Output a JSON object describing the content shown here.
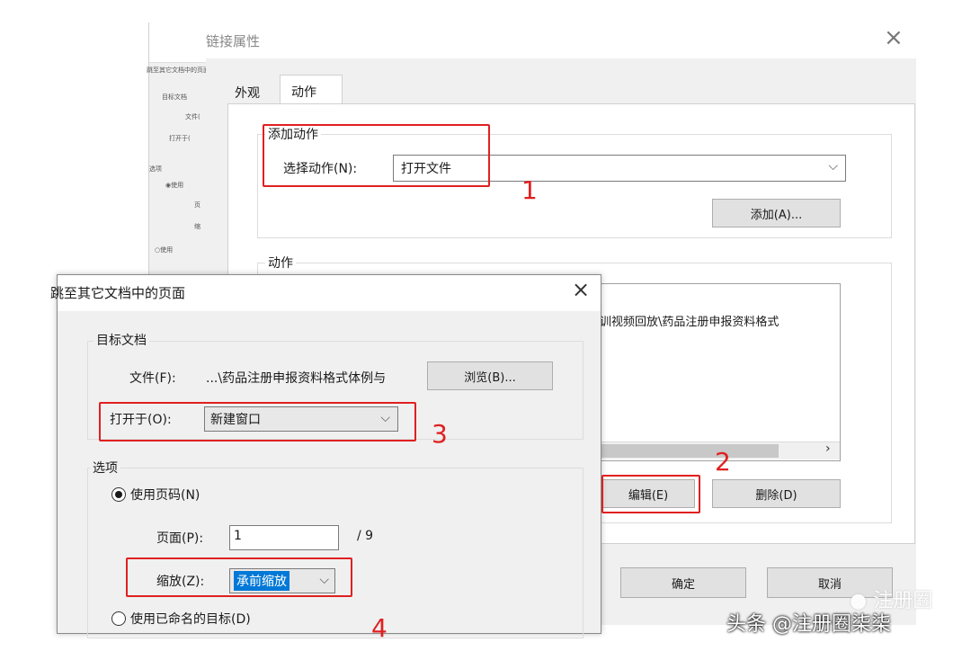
{
  "background_dialog": {
    "title": "跳至其它文档中的页面",
    "items": [
      "目标文档",
      "文件(",
      "打开于(",
      "选项",
      "使用",
      "页",
      "缩",
      "使用"
    ]
  },
  "link_dialog": {
    "title": "链接属性",
    "close_glyph": "×",
    "tabs": [
      {
        "label": "外观"
      },
      {
        "label": "动作"
      }
    ],
    "add_action": {
      "legend": "添加动作",
      "select_label": "选择动作(N):",
      "select_value": "打开文件",
      "add_button": "添加(A)..."
    },
    "actions": {
      "legend": "动作",
      "list_item": "训视频回放\\药品注册申报资料格式",
      "edit_button": "编辑(E)",
      "delete_button": "删除(D)"
    },
    "ok_button": "确定",
    "cancel_button": "取消"
  },
  "goto_dialog": {
    "title": "跳至其它文档中的页面",
    "close_glyph": "×",
    "target": {
      "legend": "目标文档",
      "file_label": "文件(F):",
      "file_value": "...\\药品注册申报资料格式体例与",
      "browse_button": "浏览(B)...",
      "open_in_label": "打开于(O):",
      "open_in_value": "新建窗口"
    },
    "options": {
      "legend": "选项",
      "use_page": "使用页码(N)",
      "page_label": "页面(P):",
      "page_value": "1",
      "page_total": "/ 9",
      "zoom_label": "缩放(Z):",
      "zoom_value": "承前缩放",
      "use_named": "使用已命名的目标(D)"
    }
  },
  "annotations": {
    "n1": "1",
    "n2": "2",
    "n3": "3",
    "n4": "4"
  },
  "watermark": {
    "text": "头条 @注册圈柒柒",
    "faint": "注册圈"
  },
  "colors": {
    "annotation_red": "#e02020",
    "selection_blue": "#0078d7"
  }
}
